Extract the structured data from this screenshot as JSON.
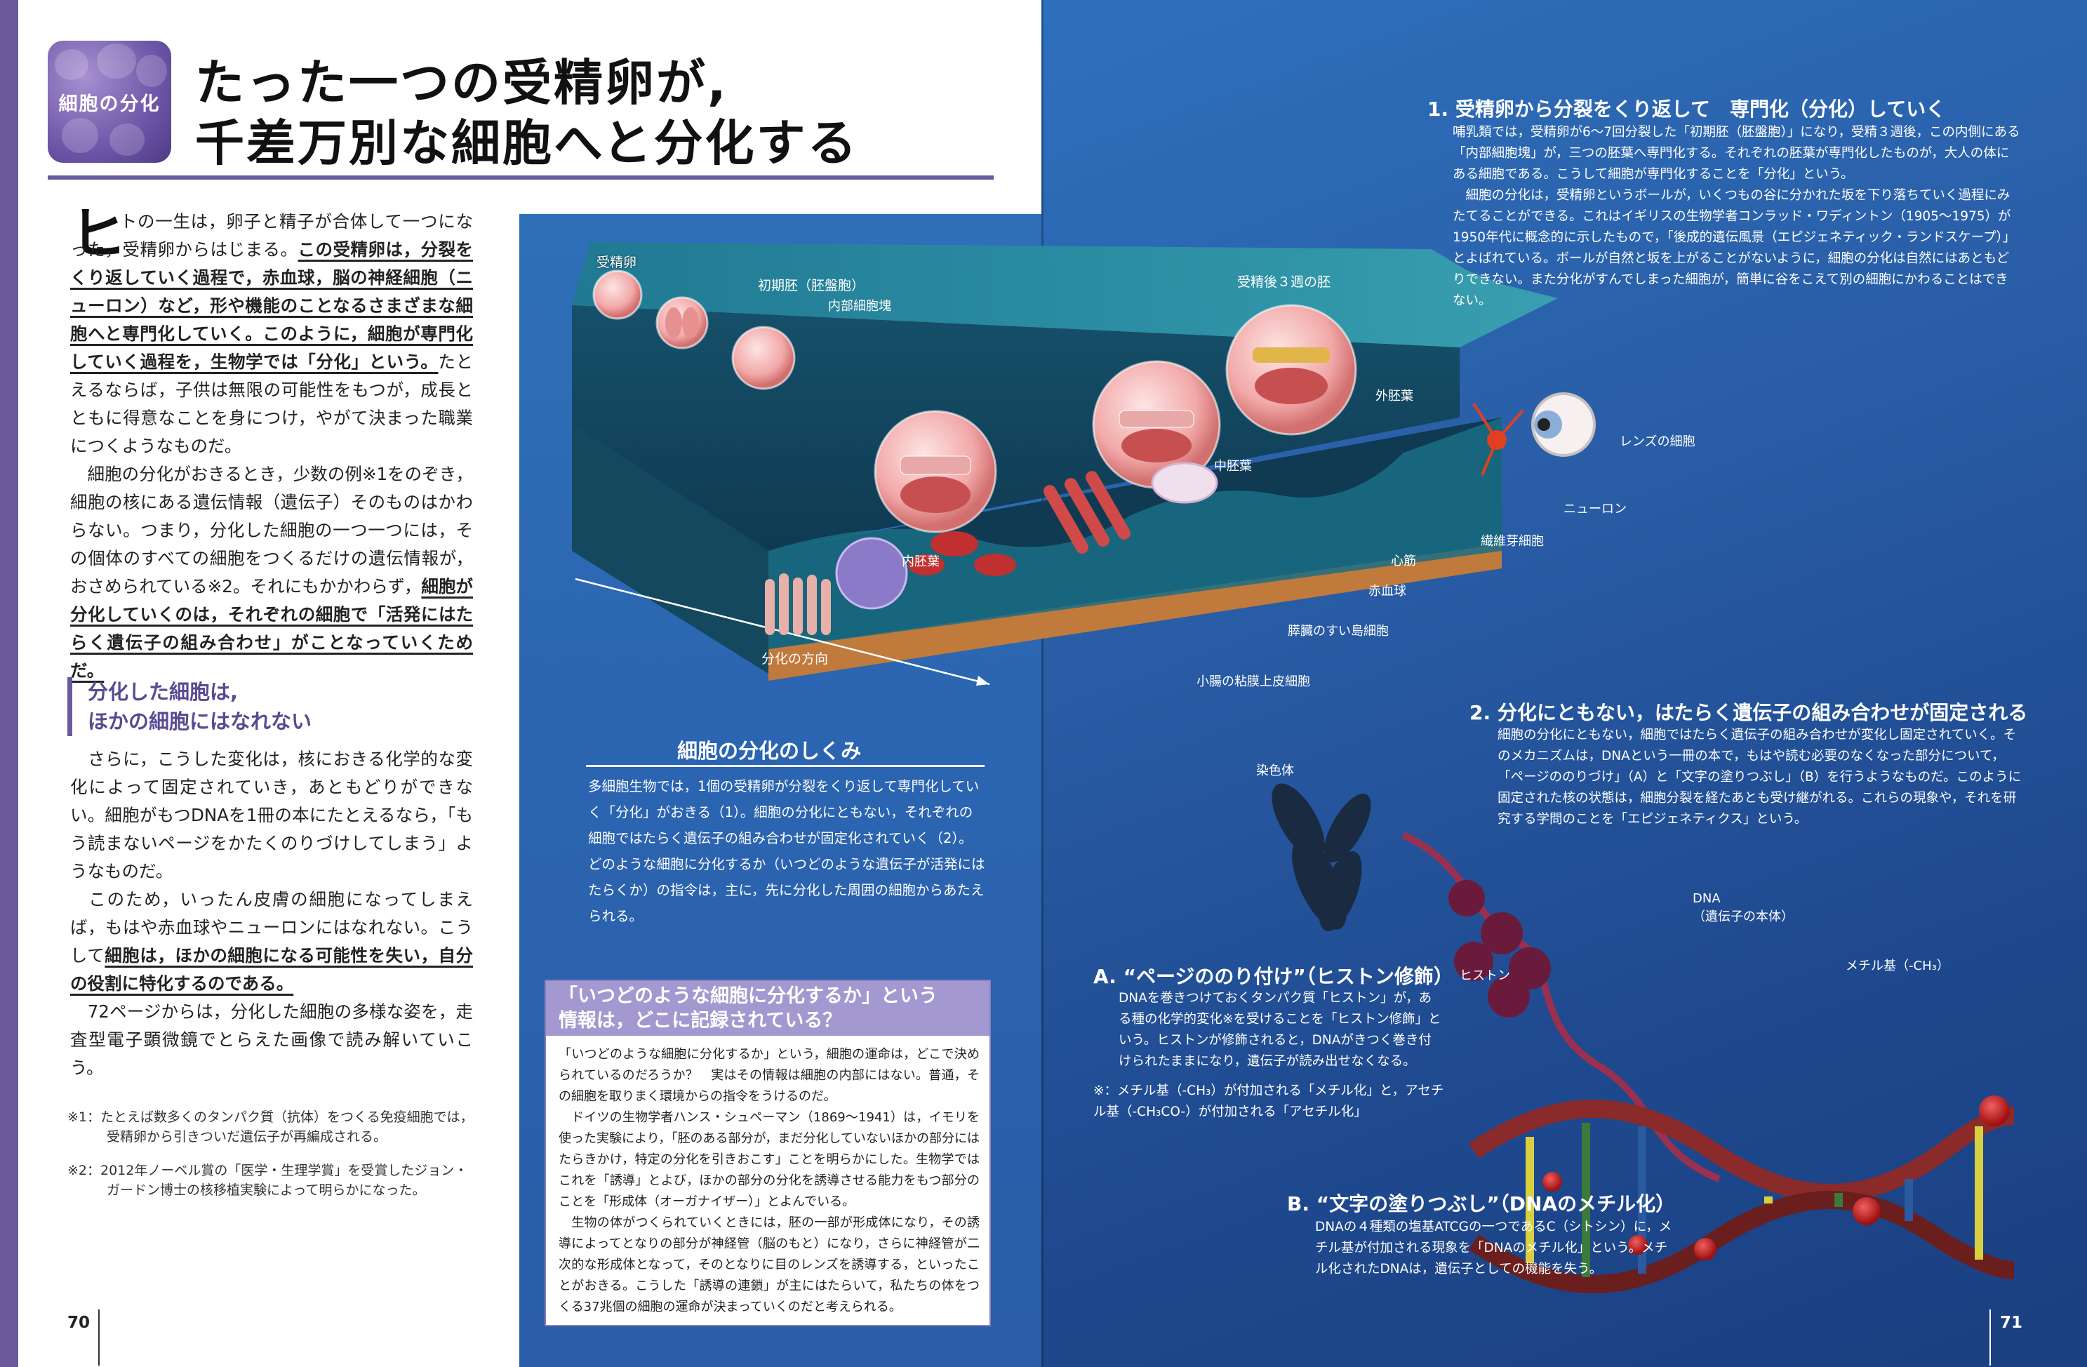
{
  "header": {
    "category_label": "細胞の分化",
    "title_line1": "たった一つの受精卵が,",
    "title_line2": "千差万別な細胞へと分化する"
  },
  "intro": {
    "drop_cap": "ヒ",
    "lead_plain": "トの一生は，卵子と精子が合体して一つになった，受精卵からはじまる。",
    "lead_bold": "この受精卵は，分裂をくり返していく過程で，赤血球，脳の神経細胞（ニューロン）など，形や機能のことなるさまざまな細胞へと専門化していく。このように，細胞が専門化していく過程を，生物学では「分化」という。",
    "lead_tail": "たとえるならば，子供は無限の可能性をもつが，成長とともに得意なことを身につけ，やがて決まった職業につくようなものだ。",
    "p2_plain": "細胞の分化がおきるとき，少数の例※1をのぞき，細胞の核にある遺伝情報（遺伝子）そのものはかわらない。つまり，分化した細胞の一つ一つには，その個体のすべての細胞をつくるだけの遺伝情報が，おさめられている※2。それにもかかわらず，",
    "p2_bold": "細胞が分化していくのは，それぞれの細胞で「活発にはたらく遺伝子の組み合わせ」がことなっていくためだ。"
  },
  "subhead": {
    "line1": "分化した細胞は,",
    "line2": "ほかの細胞にはなれない"
  },
  "section2": {
    "p1": "さらに，こうした変化は，核におきる化学的な変化によって固定されていき，あともどりができない。細胞がもつDNAを1冊の本にたとえるなら，「もう読まないページをかたくのりづけしてしまう」ようなものだ。",
    "p2_plain": "このため，いったん皮膚の細胞になってしまえば，もはや赤血球やニューロンにはなれない。こうして",
    "p2_bold": "細胞は，ほかの細胞になる可能性を失い，自分の役割に特化するのである。",
    "p3": "72ページからは，分化した細胞の多様な姿を，走査型電子顕微鏡でとらえた画像で読み解いていこう。"
  },
  "notes": {
    "n1": "※1：たとえば数多くのタンパク質（抗体）をつくる免疫細胞では，受精卵から引きついだ遺伝子が再編成される。",
    "n2": "※2：2012年ノーベル賞の「医学・生理学賞」を受賞したジョン・ガードン博士の核移植実験によって明らかになった。"
  },
  "page_numbers": {
    "left": "70",
    "right": "71"
  },
  "diagram_labels": {
    "zygote": "受精卵",
    "early_embryo": "初期胚（胚盤胞）",
    "inner_cell_mass": "内部細胞塊",
    "week3": "受精後３週の胚",
    "ectoderm": "外胚葉",
    "mesoderm": "中胚葉",
    "endoderm": "内胚葉",
    "lens": "レンズの細胞",
    "neuron": "ニューロン",
    "fibroblast": "繊維芽細胞",
    "heart": "心筋",
    "rbc": "赤血球",
    "pancreas": "膵臓のすい島細胞",
    "intestine": "小腸の粘膜上皮細胞",
    "direction": "分化の方向",
    "chromosome": "染色体",
    "dna": "DNA",
    "dna_sub": "（遺伝子の本体）",
    "histone": "ヒストン",
    "methyl": "メチル基（-CH₃）"
  },
  "mechanism": {
    "title": "細胞の分化のしくみ",
    "body": "多細胞生物では，1個の受精卵が分裂をくり返して専門化していく「分化」がおきる（1）。細胞の分化にともない，それぞれの細胞ではたらく遺伝子の組み合わせが固定化されていく（2）。どのような細胞に分化するか（いつどのような遺伝子が活発にはたらくか）の指令は，主に，先に分化した周囲の細胞からあたえられる。"
  },
  "question_box": {
    "title_line1": "「いつどのような細胞に分化するか」という",
    "title_line2": "情報は，どこに記録されている？",
    "p1": "「いつどのような細胞に分化するか」という，細胞の運命は，どこで決められているのだろうか？　実はその情報は細胞の内部にはない。普通，その細胞を取りまく環境からの指令をうけるのだ。",
    "p2": "ドイツの生物学者ハンス・シュペーマン（1869～1941）は，イモリを使った実験により，「胚のある部分が，まだ分化していないほかの部分にはたらきかけ，特定の分化を引きおこす」ことを明らかにした。生物学ではこれを「誘導」とよび，ほかの部分の分化を誘導させる能力をもつ部分のことを「形成体（オーガナイザー）」とよんでいる。",
    "p3": "生物の体がつくられていくときには，胚の一部が形成体になり，その誘導によってとなりの部分が神経管（脳のもと）になり，さらに神経管が二次的な形成体となって，そのとなりに目のレンズを誘導する，といったことがおきる。こうした「誘導の連鎖」が主にはたらいて，私たちの体をつくる37兆個の細胞の運命が決まっていくのだと考えられる。"
  },
  "section_right1": {
    "title": "1. 受精卵から分裂をくり返して　専門化（分化）していく",
    "p1": "哺乳類では，受精卵が6～7回分裂した「初期胚（胚盤胞）」になり，受精３週後，この内側にある「内部細胞塊」が，三つの胚葉へ専門化する。それぞれの胚葉が専門化したものが，大人の体にある細胞である。こうして細胞が専門化することを「分化」という。",
    "p2": "細胞の分化は，受精卵というボールが，いくつもの谷に分かれた坂を下り落ちていく過程にみたてることができる。これはイギリスの生物学者コンラッド・ワディントン（1905～1975）が1950年代に概念的に示したもので，「後成的遺伝風景（エピジェネティック・ランドスケープ）」とよばれている。ボールが自然と坂を上がることがないように，細胞の分化は自然にはあともどりできない。また分化がすんでしまった細胞が，簡単に谷をこえて別の細胞にかわることはできない。"
  },
  "section_right2": {
    "title": "2. 分化にともない，はたらく遺伝子の組み合わせが固定される",
    "body": "細胞の分化にともない，細胞ではたらく遺伝子の組み合わせが変化し固定されていく。そのメカニズムは，DNAという一冊の本で，もはや読む必要のなくなった部分について，「ページののりづけ」（A）と「文字の塗りつぶし」（B）を行うようなものだ。このように固定された核の状態は，細胞分裂を経たあとも受け継がれる。これらの現象や，それを研究する学問のことを「エピジェネティクス」という。"
  },
  "section_a": {
    "title": "A. “ページののり付け”（ヒストン修飾）",
    "body": "DNAを巻きつけておくタンパク質「ヒストン」が，ある種の化学的変化※を受けることを「ヒストン修飾」という。ヒストンが修飾されると，DNAがきつく巻き付けられたままになり，遺伝子が読み出せなくなる。",
    "note": "※：メチル基（-CH₃）が付加される「メチル化」と，アセチル基（-CH₃CO-）が付加される「アセチル化」"
  },
  "section_b": {
    "title": "B. “文字の塗りつぶし”（DNAのメチル化）",
    "body": "DNAの４種類の塩基ATCGの一つであるC（シトシン）に，メチル基が付加される現象を「DNAのメチル化」という。メチル化されたDNAは，遺伝子としての機能を失う。"
  },
  "colors": {
    "accent": "#6a5a9c",
    "blue_panel": "#2f6fb8",
    "box_title": "#a398cf"
  }
}
